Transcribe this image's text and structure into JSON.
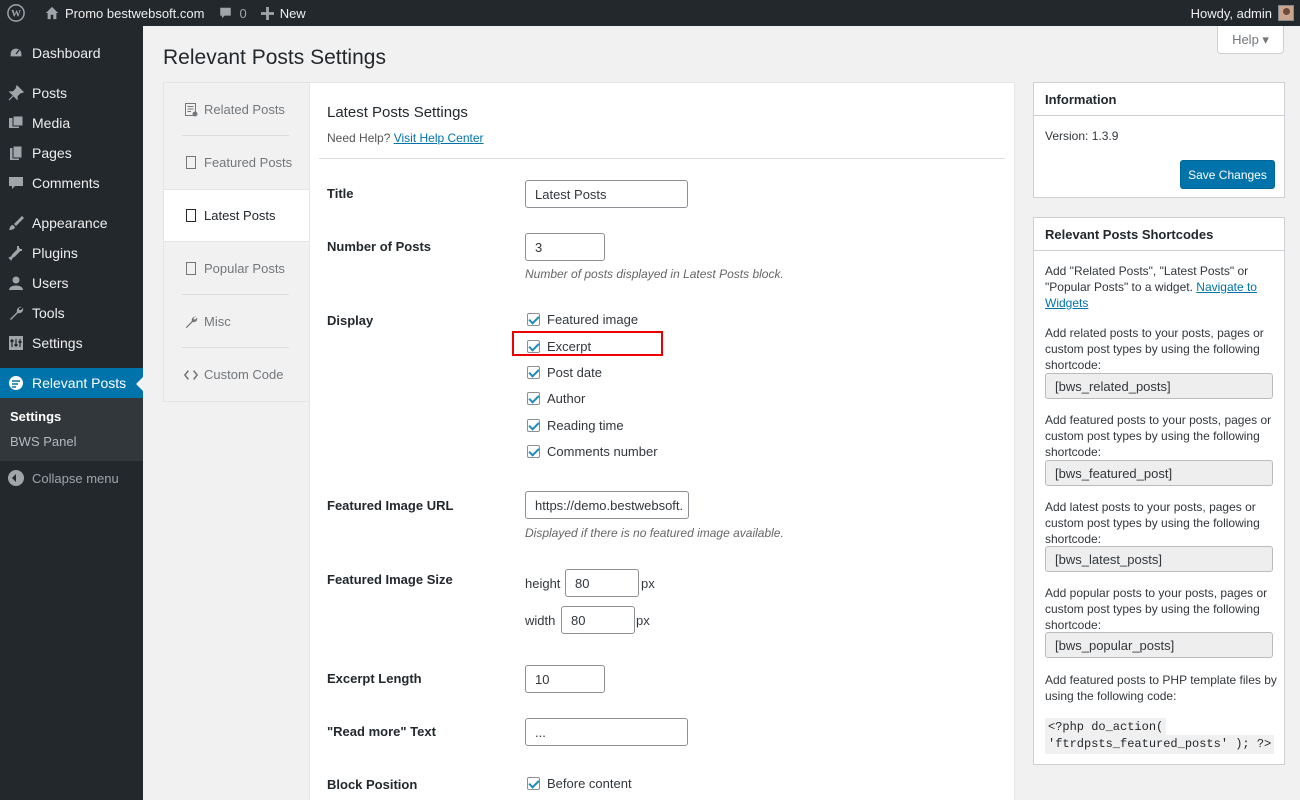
{
  "adminbar": {
    "site_name": "Promo bestwebsoft.com",
    "comments_count": "0",
    "new_label": "New",
    "howdy": "Howdy, admin"
  },
  "sidebar": {
    "items": [
      {
        "label": "Dashboard",
        "icon": "dashboard-icon"
      },
      {
        "label": "Posts",
        "icon": "pin-icon"
      },
      {
        "label": "Media",
        "icon": "media-icon"
      },
      {
        "label": "Pages",
        "icon": "pages-icon"
      },
      {
        "label": "Comments",
        "icon": "comment-icon"
      },
      {
        "label": "Appearance",
        "icon": "brush-icon"
      },
      {
        "label": "Plugins",
        "icon": "plugin-icon"
      },
      {
        "label": "Users",
        "icon": "user-icon"
      },
      {
        "label": "Tools",
        "icon": "wrench-icon"
      },
      {
        "label": "Settings",
        "icon": "settings-icon"
      },
      {
        "label": "Relevant Posts",
        "icon": "bws-icon"
      }
    ],
    "submenu": [
      "Settings",
      "BWS Panel"
    ],
    "collapse_label": "Collapse menu"
  },
  "header": {
    "title": "Relevant Posts Settings",
    "help_label": "Help ▾"
  },
  "tabs": [
    {
      "label": "Related Posts"
    },
    {
      "label": "Featured Posts"
    },
    {
      "label": "Latest Posts"
    },
    {
      "label": "Popular Posts"
    },
    {
      "label": "Misc"
    },
    {
      "label": "Custom Code"
    }
  ],
  "main": {
    "section_title": "Latest Posts Settings",
    "need_help": "Need Help?",
    "help_link": "Visit Help Center",
    "title_label": "Title",
    "title_value": "Latest Posts",
    "num_label": "Number of Posts",
    "num_value": "3",
    "num_desc": "Number of posts displayed in Latest Posts block.",
    "display_label": "Display",
    "display_options": [
      "Featured image",
      "Excerpt",
      "Post date",
      "Author",
      "Reading time",
      "Comments number"
    ],
    "img_url_label": "Featured Image URL",
    "img_url_value": "https://demo.bestwebsoft.",
    "img_url_desc": "Displayed if there is no featured image available.",
    "img_size_label": "Featured Image Size",
    "height_label": "height",
    "height_value": "80",
    "width_label": "width",
    "width_value": "80",
    "px": "px",
    "excerpt_len_label": "Excerpt Length",
    "excerpt_len_value": "10",
    "read_more_label": "\"Read more\" Text",
    "read_more_value": "...",
    "block_pos_label": "Block Position",
    "block_pos_option": "Before content"
  },
  "info": {
    "title": "Information",
    "version": "Version: 1.3.9",
    "save_label": "Save Changes"
  },
  "shortcodes": {
    "title": "Relevant Posts Shortcodes",
    "intro": "Add \"Related Posts\", \"Latest Posts\" or \"Popular Posts\" to a widget.",
    "intro_link": "Navigate to Widgets",
    "related_text": "Add related posts to your posts, pages or custom post types by using the following shortcode:",
    "related_code": "[bws_related_posts]",
    "featured_text": "Add featured posts to your posts, pages or custom post types by using the following shortcode:",
    "featured_code": "[bws_featured_post]",
    "latest_text": "Add latest posts to your posts, pages or custom post types by using the following shortcode:",
    "latest_code": "[bws_latest_posts]",
    "popular_text": "Add popular posts to your posts, pages or custom post types by using the following shortcode:",
    "popular_code": "[bws_popular_posts]",
    "php_text": "Add featured posts to PHP template files by using the following code:",
    "php_code_1": "<?php do_action(",
    "php_code_2": "'ftrdpsts_featured_posts' ); ?>"
  }
}
